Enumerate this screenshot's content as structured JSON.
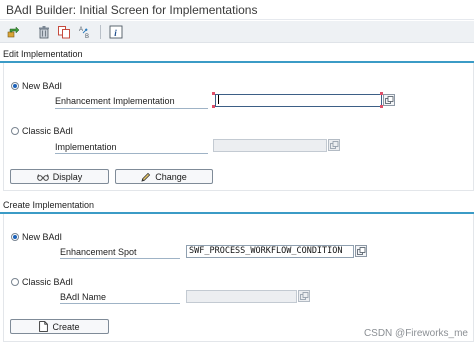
{
  "window": {
    "title": "BAdI Builder: Initial Screen for Implementations"
  },
  "toolbar": {
    "items": [
      {
        "icon": "other-object-icon"
      },
      {
        "icon": "delete-trash-icon"
      },
      {
        "icon": "copy-icon"
      },
      {
        "icon": "rename-icon"
      },
      {
        "icon": "info-icon"
      }
    ]
  },
  "edit_group": {
    "title": "Edit Implementation",
    "radio_new": {
      "label": "New BAdI",
      "selected": true
    },
    "enh_impl_label": "Enhancement Implementation",
    "enh_impl_value": "",
    "radio_classic": {
      "label": "Classic BAdI",
      "selected": false
    },
    "impl_label": "Implementation",
    "impl_value": "",
    "display_button": "Display",
    "change_button": "Change"
  },
  "create_group": {
    "title": "Create Implementation",
    "radio_new": {
      "label": "New BAdI",
      "selected": true
    },
    "enh_spot_label": "Enhancement Spot",
    "enh_spot_value": "SWF_PROCESS_WORKFLOW_CONDITION",
    "radio_classic": {
      "label": "Classic BAdI",
      "selected": false
    },
    "badi_name_label": "BAdI Name",
    "badi_name_value": "",
    "create_button": "Create"
  },
  "watermark": "CSDN @Fireworks_me",
  "colors": {
    "group_rule": "#3b9bc6",
    "toolbar_bg": "#eef1f4",
    "radio_selected": "#1c62b9"
  }
}
